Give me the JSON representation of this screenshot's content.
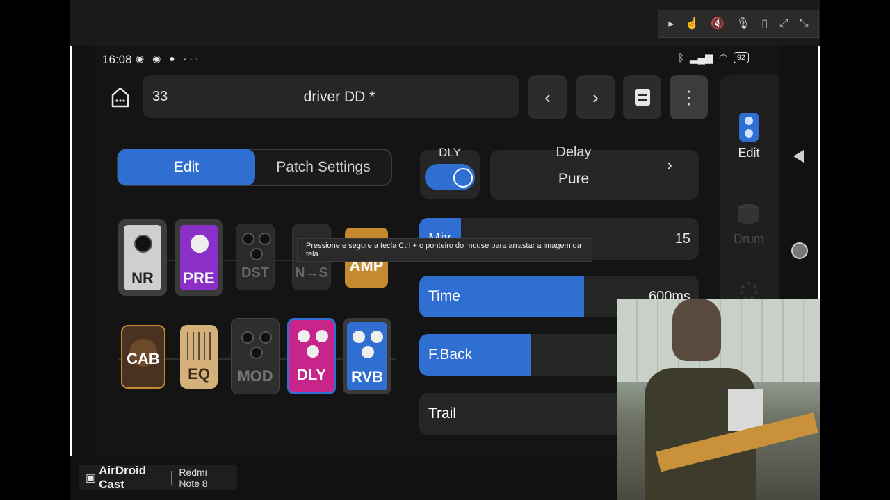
{
  "status": {
    "time": "16:08",
    "battery": "92",
    "more": "···"
  },
  "header": {
    "patch_number": "33",
    "patch_name": "driver DD *"
  },
  "tabs": {
    "edit": "Edit",
    "patch_settings": "Patch Settings"
  },
  "chain_row1": [
    {
      "label": "NR"
    },
    {
      "label": "PRE"
    },
    {
      "label": "DST"
    },
    {
      "label": "N→S"
    },
    {
      "label": "AMP"
    }
  ],
  "chain_row2": [
    {
      "label": "CAB"
    },
    {
      "label": "EQ"
    },
    {
      "label": "MOD"
    },
    {
      "label": "DLY"
    },
    {
      "label": "RVB"
    }
  ],
  "effect": {
    "block": "DLY",
    "enabled": true,
    "category": "Delay",
    "type": "Pure"
  },
  "params": [
    {
      "name": "Mix",
      "value": "15",
      "level": 0.15
    },
    {
      "name": "Time",
      "value": "600ms",
      "level": 0.59
    },
    {
      "name": "F.Back",
      "value": "",
      "level": 0.4
    },
    {
      "name": "Trail",
      "value": "",
      "level": 0
    }
  ],
  "sidebar": {
    "edit": "Edit",
    "drum": "Drum"
  },
  "tooltip": "Pressione e segure a tecla Ctrl + o ponteiro do mouse para arrastar a imagem da tela",
  "cast": {
    "brand": "AirDroid Cast",
    "device": "Redmi Note 8"
  },
  "colors": {
    "accent": "#2f6fd1",
    "pre": "#8b2fc9",
    "dly": "#c7258a",
    "rvb": "#2f6fd1",
    "amp": "#c68a2e",
    "eq": "#d6b07a"
  }
}
